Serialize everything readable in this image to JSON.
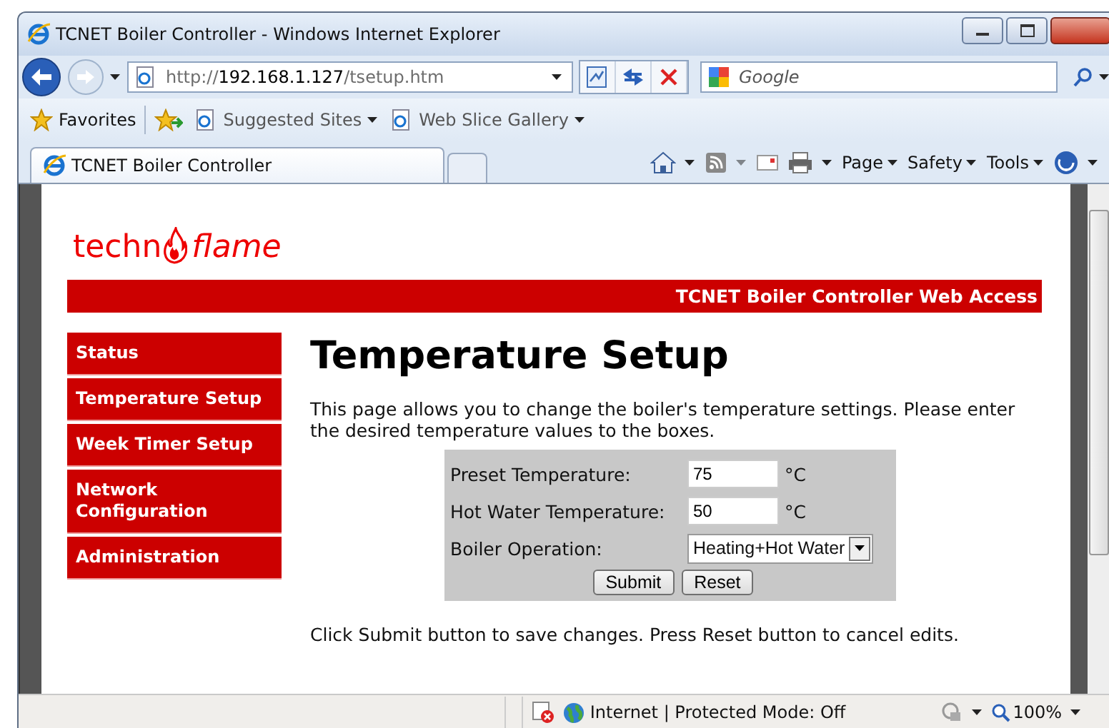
{
  "window": {
    "title": "TCNET Boiler Controller - Windows Internet Explorer"
  },
  "address_bar": {
    "url": [
      {
        "text": "http://",
        "emphasis": false
      },
      {
        "text": "192.168.1.127",
        "emphasis": true
      },
      {
        "text": "/tsetup.htm",
        "emphasis": false
      }
    ]
  },
  "search": {
    "placeholder": "Google"
  },
  "favorites_bar": {
    "favorites": "Favorites",
    "links": [
      {
        "label": "Suggested Sites"
      },
      {
        "label": "Web Slice Gallery"
      }
    ]
  },
  "tabs": [
    {
      "label": "TCNET Boiler Controller",
      "selected": true
    }
  ],
  "command_bar": [
    {
      "label": "Page"
    },
    {
      "label": "Safety"
    },
    {
      "label": "Tools"
    }
  ],
  "page": {
    "logo": {
      "first": "techn",
      "second": "flame"
    },
    "banner": "TCNET Boiler Controller Web Access",
    "nav": [
      {
        "label": "Status"
      },
      {
        "label": "Temperature Setup"
      },
      {
        "label": "Week Timer Setup"
      },
      {
        "label": "Network Configuration"
      },
      {
        "label": "Administration"
      }
    ],
    "heading": "Temperature Setup",
    "intro": "This page allows you to change the boiler's temperature settings. Please enter the desired temperature values to the boxes.",
    "form": [
      {
        "kind": "number",
        "label": "Preset Temperature:",
        "value": "75",
        "unit": "°C"
      },
      {
        "kind": "number",
        "label": "Hot Water Temperature:",
        "value": "50",
        "unit": "°C"
      },
      {
        "kind": "select",
        "label": "Boiler Operation:",
        "value": "Heating+Hot Water"
      }
    ],
    "buttons": [
      "Submit",
      "Reset"
    ],
    "note": "Click Submit button to save changes. Press Reset button to cancel edits."
  },
  "status_bar": {
    "zone": "Internet | Protected Mode: Off",
    "zoom": "100%"
  }
}
